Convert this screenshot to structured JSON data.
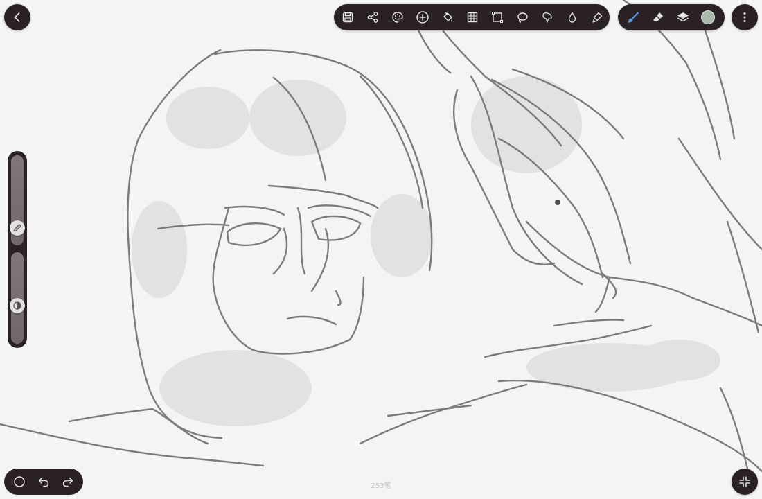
{
  "app": {
    "stroke_count": "253笔",
    "current_color": "#a9b9ac",
    "accent": "#5aa0e8"
  },
  "top_left": {
    "back_icon": "chevron-left-icon"
  },
  "main_toolbar": {
    "tools": [
      "save-icon",
      "share-icon",
      "palette-icon",
      "add-icon",
      "fill-icon",
      "grid-icon",
      "transform-icon",
      "lasso-icon",
      "select-icon",
      "smudge-icon",
      "fx-brush-icon"
    ]
  },
  "brush_toolbar": {
    "tools": [
      "brush-icon",
      "eraser-icon",
      "layers-icon",
      "color-swatch"
    ]
  },
  "left_slider": {
    "size_icon": "pencil-icon",
    "opacity_icon": "opacity-icon"
  },
  "bottom_left": {
    "tools": [
      "circle-icon",
      "undo-icon",
      "redo-icon"
    ]
  },
  "bottom_right": {
    "icon": "compress-icon"
  }
}
